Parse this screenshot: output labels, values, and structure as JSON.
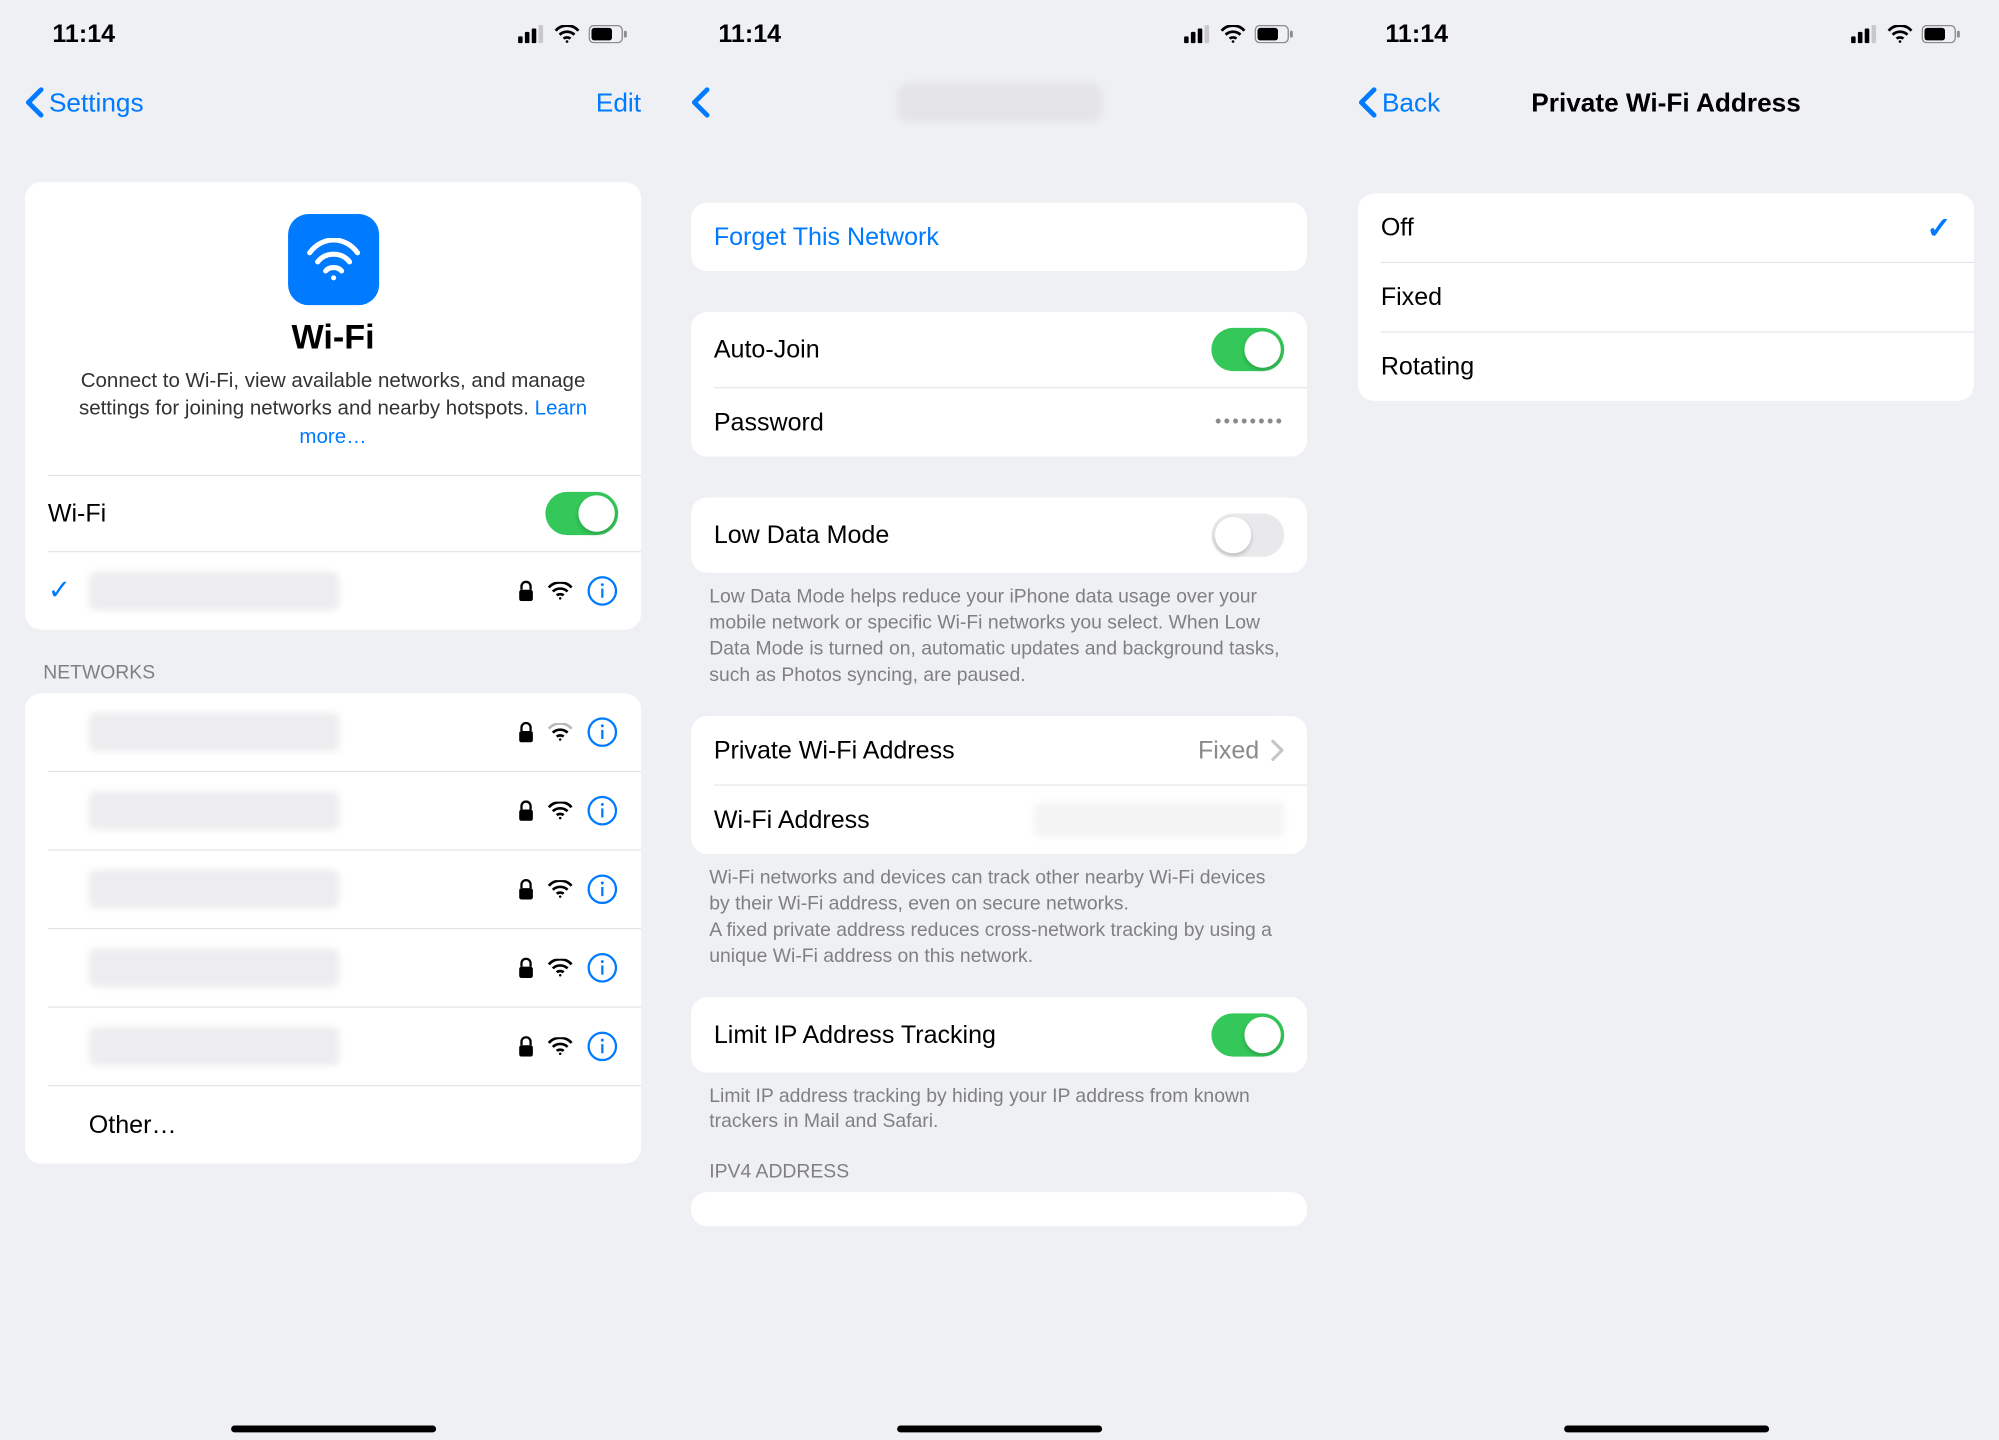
{
  "status": {
    "time": "11:14"
  },
  "panel1": {
    "nav_back": "Settings",
    "nav_edit": "Edit",
    "hero_title": "Wi-Fi",
    "hero_desc_a": "Connect to Wi-Fi, view available networks, and manage settings for joining networks and nearby hotspots. ",
    "hero_learn_more": "Learn more…",
    "wifi_toggle_label": "Wi-Fi",
    "networks_header": "NETWORKS",
    "other_label": "Other…",
    "networks": [
      {
        "weak": true
      },
      {
        "weak": false
      },
      {
        "weak": false
      },
      {
        "weak": false
      },
      {
        "weak": false
      }
    ]
  },
  "panel2": {
    "forget_label": "Forget This Network",
    "autojoin_label": "Auto-Join",
    "password_label": "Password",
    "password_dots": "••••••••",
    "lowdata_label": "Low Data Mode",
    "lowdata_desc": "Low Data Mode helps reduce your iPhone data usage over your mobile network or specific Wi-Fi networks you select. When Low Data Mode is turned on, automatic updates and background tasks, such as Photos syncing, are paused.",
    "private_label": "Private Wi-Fi Address",
    "private_value": "Fixed",
    "wifiaddr_label": "Wi-Fi Address",
    "wifiaddr_desc": "Wi-Fi networks and devices can track other nearby Wi-Fi devices by their Wi-Fi address, even on secure networks.\nA fixed private address reduces cross-network tracking by using a unique Wi-Fi address on this network.",
    "limit_label": "Limit IP Address Tracking",
    "limit_desc": "Limit IP address tracking by hiding your IP address from known trackers in Mail and Safari.",
    "ipv4_header": "IPV4 ADDRESS"
  },
  "panel3": {
    "nav_back": "Back",
    "title": "Private Wi-Fi Address",
    "options": [
      "Off",
      "Fixed",
      "Rotating"
    ],
    "selected": 0
  }
}
